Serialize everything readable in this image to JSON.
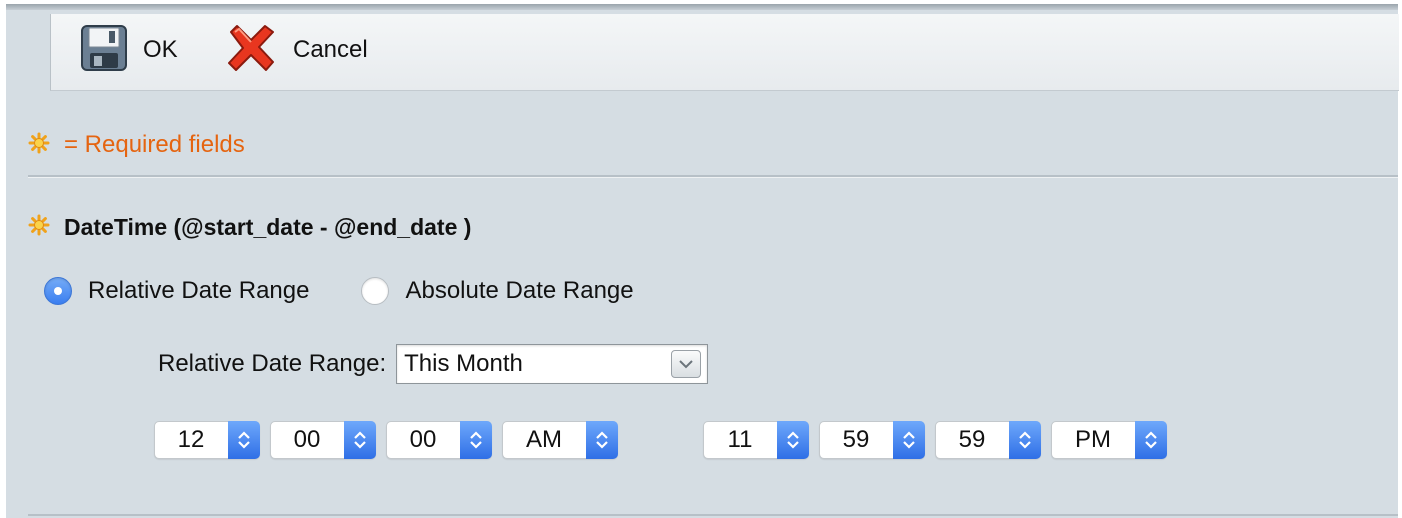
{
  "toolbar": {
    "ok_label": "OK",
    "cancel_label": "Cancel"
  },
  "required_note": "= Required fields",
  "section": {
    "title": "DateTime (@start_date - @end_date )"
  },
  "range_mode": {
    "options": [
      {
        "label": "Relative Date Range",
        "selected": true
      },
      {
        "label": "Absolute Date Range",
        "selected": false
      }
    ]
  },
  "relative_range": {
    "label": "Relative Date Range:",
    "value": "This Month"
  },
  "start_time": {
    "hour": "12",
    "minute": "00",
    "second": "00",
    "ampm": "AM"
  },
  "end_time": {
    "hour": "11",
    "minute": "59",
    "second": "59",
    "ampm": "PM"
  },
  "colors": {
    "required": "#e56410",
    "accent": "#3a7ef0",
    "panel": "#d5dde3"
  }
}
